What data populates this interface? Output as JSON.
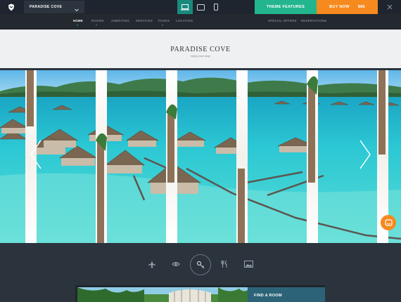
{
  "topbar": {
    "theme_name": "PARADISE COVE",
    "devices": [
      "desktop-icon",
      "tablet-icon",
      "mobile-icon"
    ],
    "features_label": "THEME FEATURES",
    "buy_label": "BUY NOW",
    "price": "$86",
    "colors": {
      "features": "#23b58e",
      "buy": "#f68a1f",
      "active_device": "#1a8a7d"
    }
  },
  "nav": {
    "left": [
      {
        "label": "HOME",
        "active": true
      },
      {
        "label": "ROOMS",
        "dropdown": true
      },
      {
        "label": "AMENITIES"
      },
      {
        "label": "SERVICES"
      },
      {
        "label": "PAGES",
        "dropdown": true
      },
      {
        "label": "LOCATION"
      }
    ],
    "right": [
      {
        "label": "SPECIAL OFFERS"
      },
      {
        "label": "RESERVATIONS"
      }
    ]
  },
  "header": {
    "title": "PARADISE COVE",
    "tagline": "enjoy your stay"
  },
  "slider": {
    "prev_icon": "chevron-left-icon",
    "next_icon": "chevron-right-icon"
  },
  "iconbar": {
    "icons": [
      "plane-icon",
      "eye-icon",
      "key-icon",
      "restaurant-icon",
      "gallery-icon"
    ],
    "active": "key-icon"
  },
  "booking": {
    "find_room_label": "FIND A ROOM"
  },
  "chat_icon": "chat-icon"
}
